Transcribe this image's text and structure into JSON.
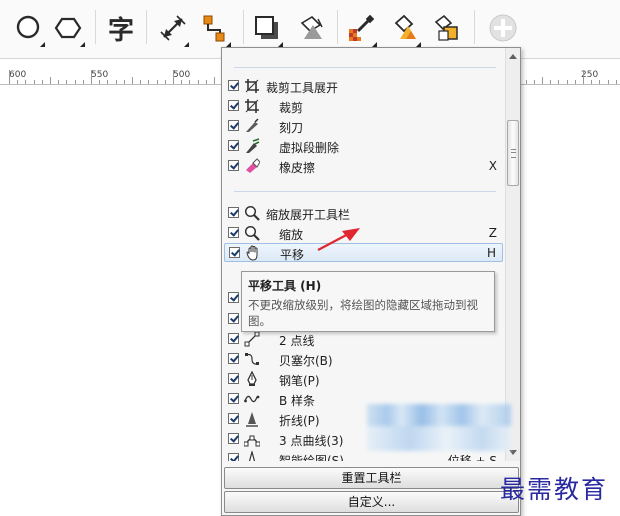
{
  "toolbar": {
    "buttons": [
      {
        "name": "ellipse-tool",
        "icon": "ellipse-icon"
      },
      {
        "name": "polygon-tool",
        "icon": "hexagon-icon"
      },
      {
        "name": "text-tool",
        "icon": "text-icon",
        "label": "字"
      },
      {
        "name": "dimension-tool",
        "icon": "dimension-arrow-icon"
      },
      {
        "name": "connector-tool",
        "icon": "connector-icon"
      },
      {
        "name": "drop-shadow-tool",
        "icon": "drop-shadow-icon"
      },
      {
        "name": "transparency-tool",
        "icon": "transparency-icon"
      },
      {
        "name": "color-eyedropper-tool",
        "icon": "eyedropper-icon"
      },
      {
        "name": "interactive-fill-tool",
        "icon": "fill-bucket-icon"
      },
      {
        "name": "smart-fill-tool",
        "icon": "smart-fill-icon"
      },
      {
        "name": "add-tool",
        "icon": "plus-circle-icon"
      }
    ]
  },
  "ruler": {
    "labels": [
      "600",
      "550",
      "500",
      "250"
    ]
  },
  "menu": {
    "items": [
      {
        "icon": "crop-icon",
        "label": "裁剪工具展开",
        "key": "",
        "indent": 1
      },
      {
        "icon": "crop-icon",
        "label": "裁剪",
        "key": "",
        "indent": 2
      },
      {
        "icon": "knife-icon",
        "label": "刻刀",
        "key": "",
        "indent": 2
      },
      {
        "icon": "virtual-segment-delete-icon",
        "label": "虚拟段删除",
        "key": "",
        "indent": 2
      },
      {
        "icon": "eraser-icon",
        "label": "橡皮擦",
        "key": "X",
        "indent": 2
      },
      {
        "icon": "zoom-icon",
        "label": "缩放展开工具栏",
        "key": "",
        "indent": 1
      },
      {
        "icon": "zoom-icon",
        "label": "缩放",
        "key": "Z",
        "indent": 2
      },
      {
        "icon": "pan-hand-icon",
        "label": "平移",
        "key": "H",
        "indent": 2,
        "highlighted": true
      },
      {
        "icon": "two-point-line-icon",
        "label": "2 点线",
        "key": "",
        "indent": 2
      },
      {
        "icon": "bezier-icon",
        "label": "贝塞尔(B)",
        "key": "",
        "indent": 2
      },
      {
        "icon": "pen-icon",
        "label": "钢笔(P)",
        "key": "",
        "indent": 2
      },
      {
        "icon": "b-spline-icon",
        "label": "B 样条",
        "key": "",
        "indent": 2
      },
      {
        "icon": "polyline-icon",
        "label": "折线(P)",
        "key": "",
        "indent": 2
      },
      {
        "icon": "three-point-curve-icon",
        "label": "3 点曲线(3)",
        "key": "",
        "indent": 2
      },
      {
        "icon": "smart-drawing-icon",
        "label": "智能绘图(S)",
        "key": "位移 + S",
        "indent": 2
      }
    ],
    "reset_label": "重置工具栏",
    "customize_label": "自定义..."
  },
  "tooltip": {
    "title": "平移工具 (H)",
    "body": "不更改缩放级别，将绘图的隐藏区域拖动到视图。"
  },
  "watermark": "最需教育",
  "colors": {
    "annotation_arrow": "#e0262f",
    "highlight": "#dce9f7",
    "watermark": "#2a2aa0"
  }
}
